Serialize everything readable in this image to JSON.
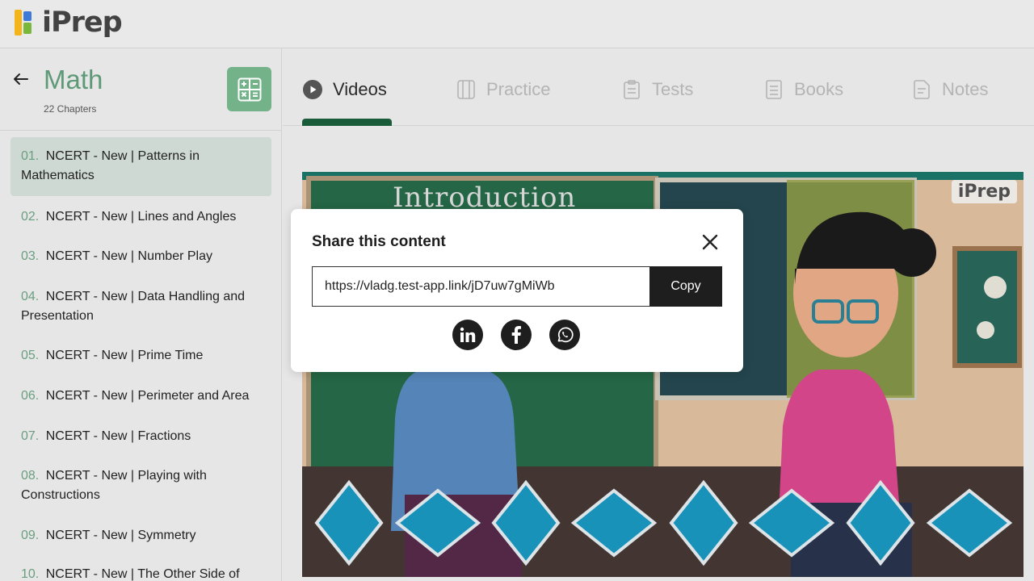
{
  "app": {
    "logo_text": "iPrep"
  },
  "sidebar": {
    "subject": "Math",
    "chapter_count": "22 Chapters",
    "chapters": [
      {
        "num": "01.",
        "title": "NCERT - New | Patterns in Mathematics"
      },
      {
        "num": "02.",
        "title": "NCERT - New | Lines and Angles"
      },
      {
        "num": "03.",
        "title": "NCERT - New | Number Play"
      },
      {
        "num": "04.",
        "title": "NCERT - New | Data Handling and Presentation"
      },
      {
        "num": "05.",
        "title": "NCERT - New | Prime Time"
      },
      {
        "num": "06.",
        "title": "NCERT - New | Perimeter and Area"
      },
      {
        "num": "07.",
        "title": "NCERT - New | Fractions"
      },
      {
        "num": "08.",
        "title": "NCERT - New | Playing with Constructions"
      },
      {
        "num": "09.",
        "title": "NCERT - New | Symmetry"
      },
      {
        "num": "10.",
        "title": "NCERT - New | The Other Side of"
      }
    ]
  },
  "tabs": [
    {
      "label": "Videos",
      "icon": "play-circle-icon",
      "active": true
    },
    {
      "label": "Practice",
      "icon": "practice-icon",
      "active": false
    },
    {
      "label": "Tests",
      "icon": "clipboard-icon",
      "active": false
    },
    {
      "label": "Books",
      "icon": "book-icon",
      "active": false
    },
    {
      "label": "Notes",
      "icon": "notes-icon",
      "active": false
    }
  ],
  "video": {
    "board_text": "Introduction",
    "watermark": "iPrep"
  },
  "share_modal": {
    "title": "Share this content",
    "link": "https://vladg.test-app.link/jD7uw7gMiWb",
    "copy_label": "Copy",
    "socials": [
      "linkedin-icon",
      "facebook-icon",
      "whatsapp-icon"
    ]
  },
  "colors": {
    "accent_green": "#5f9a78",
    "tab_underline": "#1a5b3a",
    "calc_button": "#74b38a",
    "active_chapter_bg": "#cfd9d3"
  }
}
